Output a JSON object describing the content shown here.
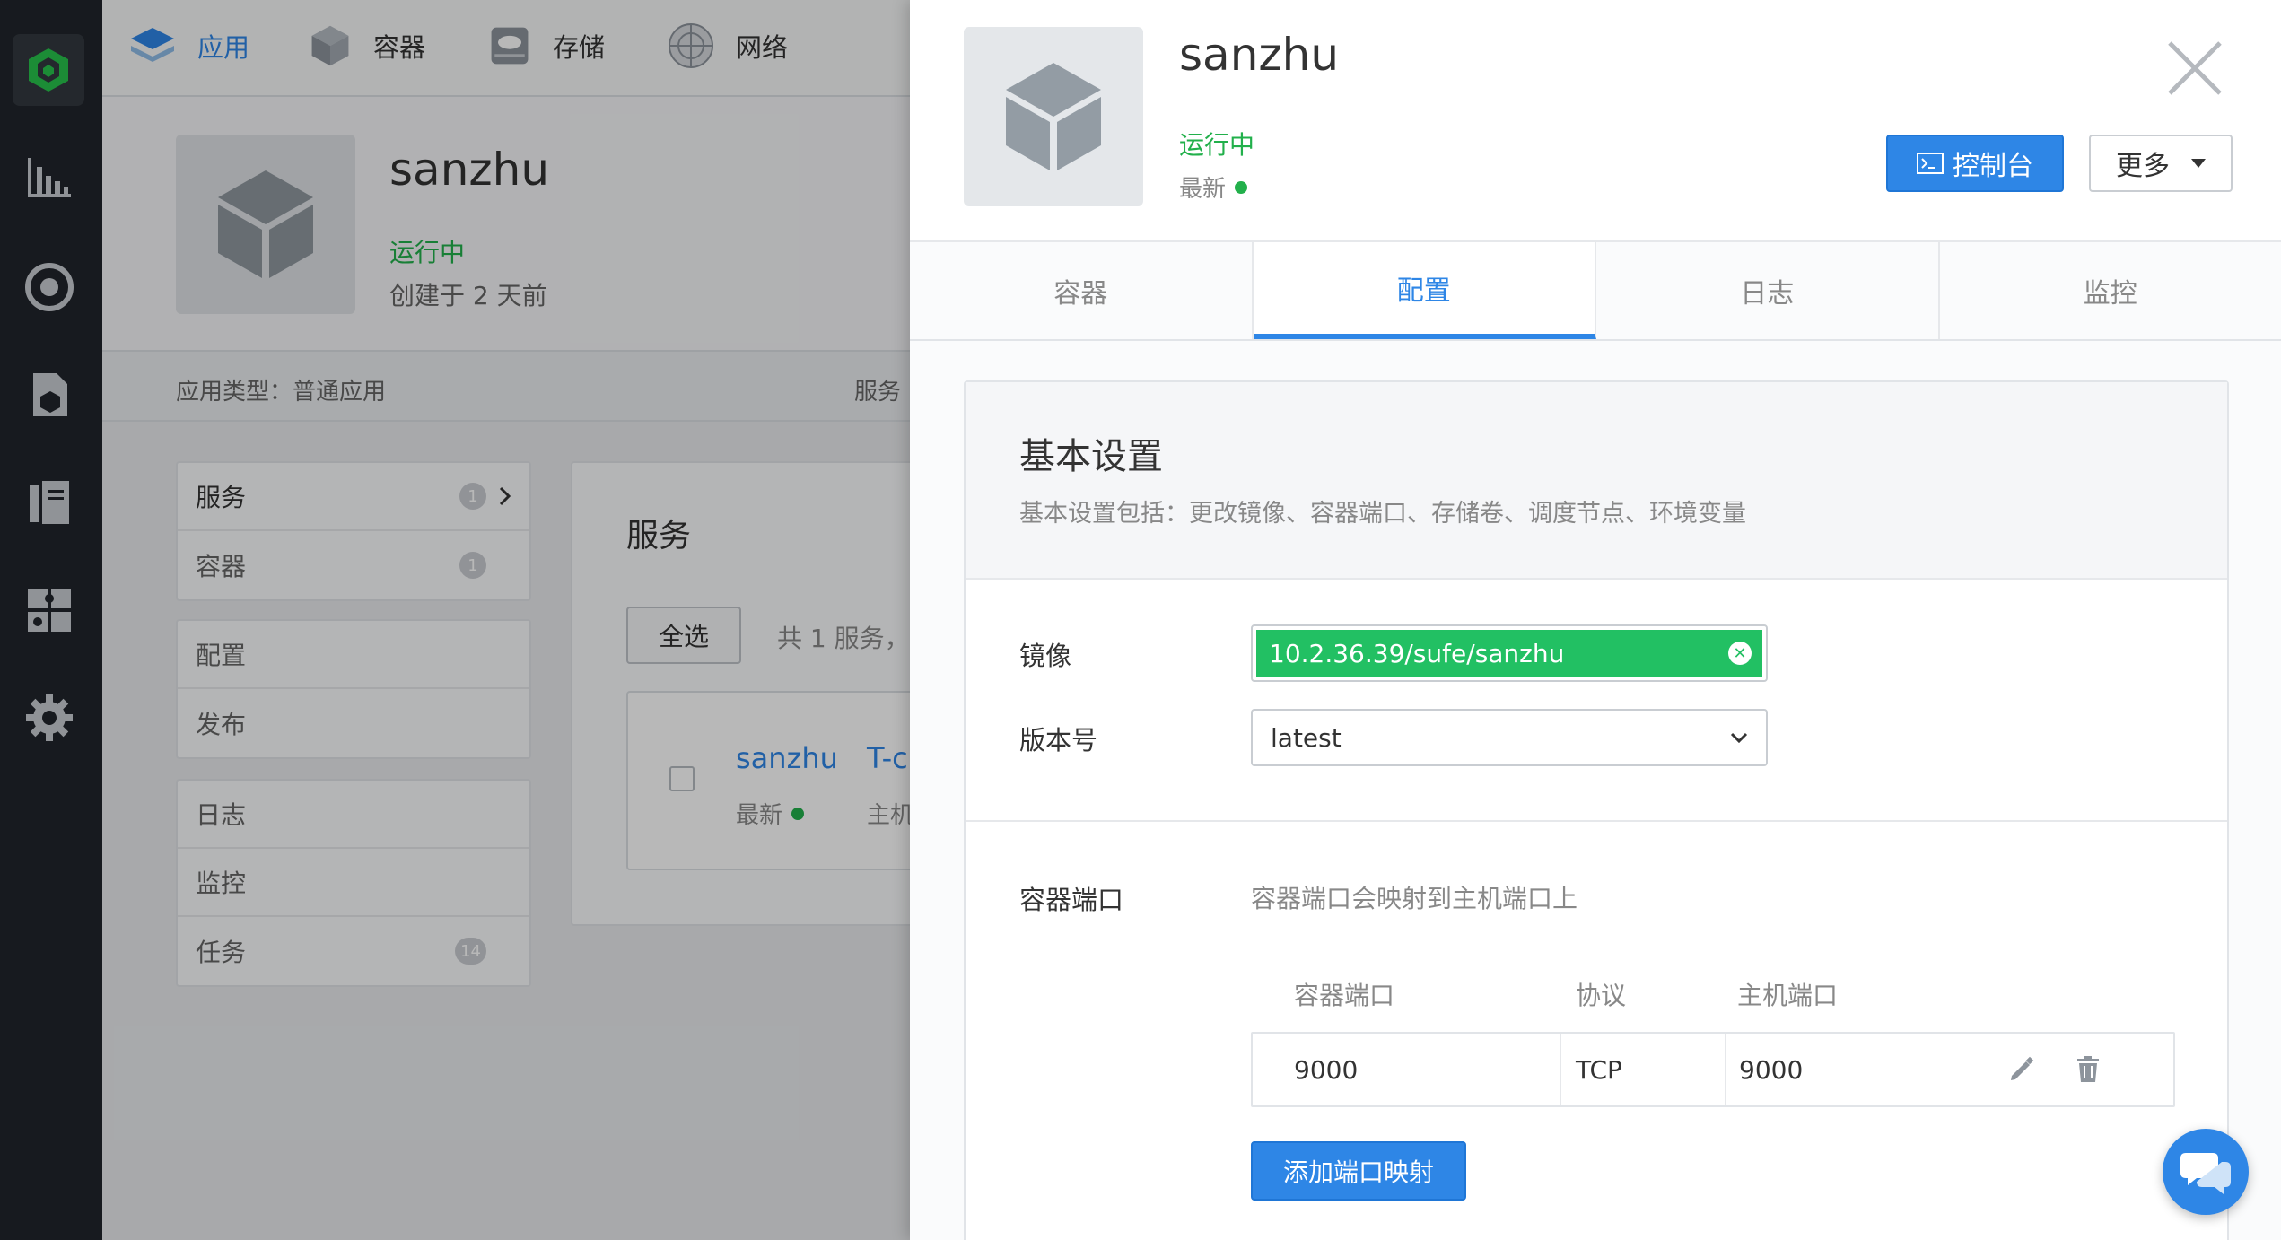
{
  "top_nav": {
    "items": [
      {
        "label": "应用",
        "icon": "layers-icon",
        "active": true
      },
      {
        "label": "容器",
        "icon": "cube-icon"
      },
      {
        "label": "存储",
        "icon": "storage-icon"
      },
      {
        "label": "网络",
        "icon": "network-icon"
      }
    ]
  },
  "app": {
    "name": "sanzhu",
    "status": "运行中",
    "created": "创建于 2 天前",
    "type": "应用类型：普通应用",
    "services_label": "服务"
  },
  "side_menu": {
    "group1": [
      {
        "label": "服务",
        "badge": "1"
      },
      {
        "label": "容器",
        "badge": "1"
      }
    ],
    "group2": [
      {
        "label": "配置"
      },
      {
        "label": "发布"
      }
    ],
    "group3": [
      {
        "label": "日志"
      },
      {
        "label": "监控"
      },
      {
        "label": "任务",
        "badge": "14"
      }
    ]
  },
  "services_panel": {
    "title": "服务",
    "select_all": "全选",
    "count_text": "共 1 服务，",
    "row": {
      "name": "sanzhu",
      "version": "最新",
      "col2_title": "T-ci",
      "col2_sub": "主机"
    }
  },
  "drawer": {
    "name": "sanzhu",
    "status": "运行中",
    "version": "最新",
    "console_button": "控制台",
    "more_button": "更多",
    "tabs": [
      {
        "label": "容器"
      },
      {
        "label": "配置",
        "active": true
      },
      {
        "label": "日志"
      },
      {
        "label": "监控"
      }
    ],
    "basic": {
      "title": "基本设置",
      "subtitle": "基本设置包括：更改镜像、容器端口、存储卷、调度节点、环境变量",
      "image_label": "镜像",
      "image_value": "10.2.36.39/sufe/sanzhu",
      "version_label": "版本号",
      "version_value": "latest"
    },
    "ports": {
      "label": "容器端口",
      "hint": "容器端口会映射到主机端口上",
      "headers": [
        "容器端口",
        "协议",
        "主机端口"
      ],
      "rows": [
        {
          "container_port": "9000",
          "protocol": "TCP",
          "host_port": "9000"
        }
      ],
      "add_button": "添加端口映射"
    }
  },
  "colors": {
    "accent": "#2e86e6",
    "success": "#22b04b",
    "tag_green": "#22c063",
    "sidebar_bg": "#21252b"
  }
}
